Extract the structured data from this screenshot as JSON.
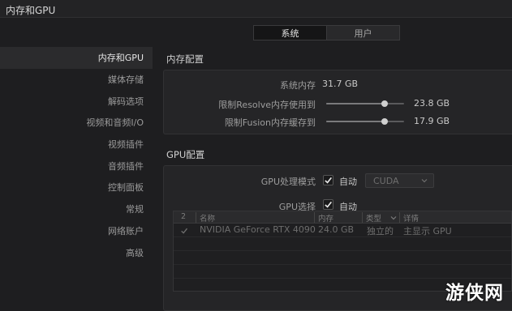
{
  "window": {
    "title": "内存和GPU"
  },
  "tabs": [
    {
      "label": "系统",
      "active": true
    },
    {
      "label": "用户",
      "active": false
    }
  ],
  "sidebar": {
    "items": [
      {
        "label": "内存和GPU",
        "active": true
      },
      {
        "label": "媒体存储"
      },
      {
        "label": "解码选项"
      },
      {
        "label": "视频和音频I/O"
      },
      {
        "label": "视频插件"
      },
      {
        "label": "音频插件"
      },
      {
        "label": "控制面板"
      },
      {
        "label": "常规"
      },
      {
        "label": "网络账户"
      },
      {
        "label": "高级"
      }
    ]
  },
  "memory": {
    "section_title": "内存配置",
    "system_memory_label": "系统内存",
    "system_memory_value": "31.7 GB",
    "resolve_limit_label": "限制Resolve内存使用到",
    "resolve_limit_value": "23.8 GB",
    "resolve_limit_fraction": 0.75,
    "fusion_limit_label": "限制Fusion内存缓存到",
    "fusion_limit_value": "17.9 GB",
    "fusion_limit_fraction": 0.75
  },
  "gpu": {
    "section_title": "GPU配置",
    "mode_label": "GPU处理模式",
    "mode_auto_checked": true,
    "mode_auto_label": "自动",
    "mode_dropdown_value": "CUDA",
    "select_label": "GPU选择",
    "select_auto_checked": true,
    "select_auto_label": "自动",
    "table": {
      "columns": [
        "2",
        "名称",
        "内存",
        "类型",
        "详情"
      ],
      "rows": [
        {
          "checked": true,
          "name": "NVIDIA GeForce RTX 4090",
          "memory": "24.0 GB",
          "type": "独立的",
          "detail": "主显示 GPU"
        }
      ]
    }
  },
  "watermark": {
    "text": "游侠网"
  },
  "colors": {
    "background": "#1e1e20",
    "panel": "#252527",
    "active_tab": "#151516",
    "knob": "#cfcfcf"
  }
}
